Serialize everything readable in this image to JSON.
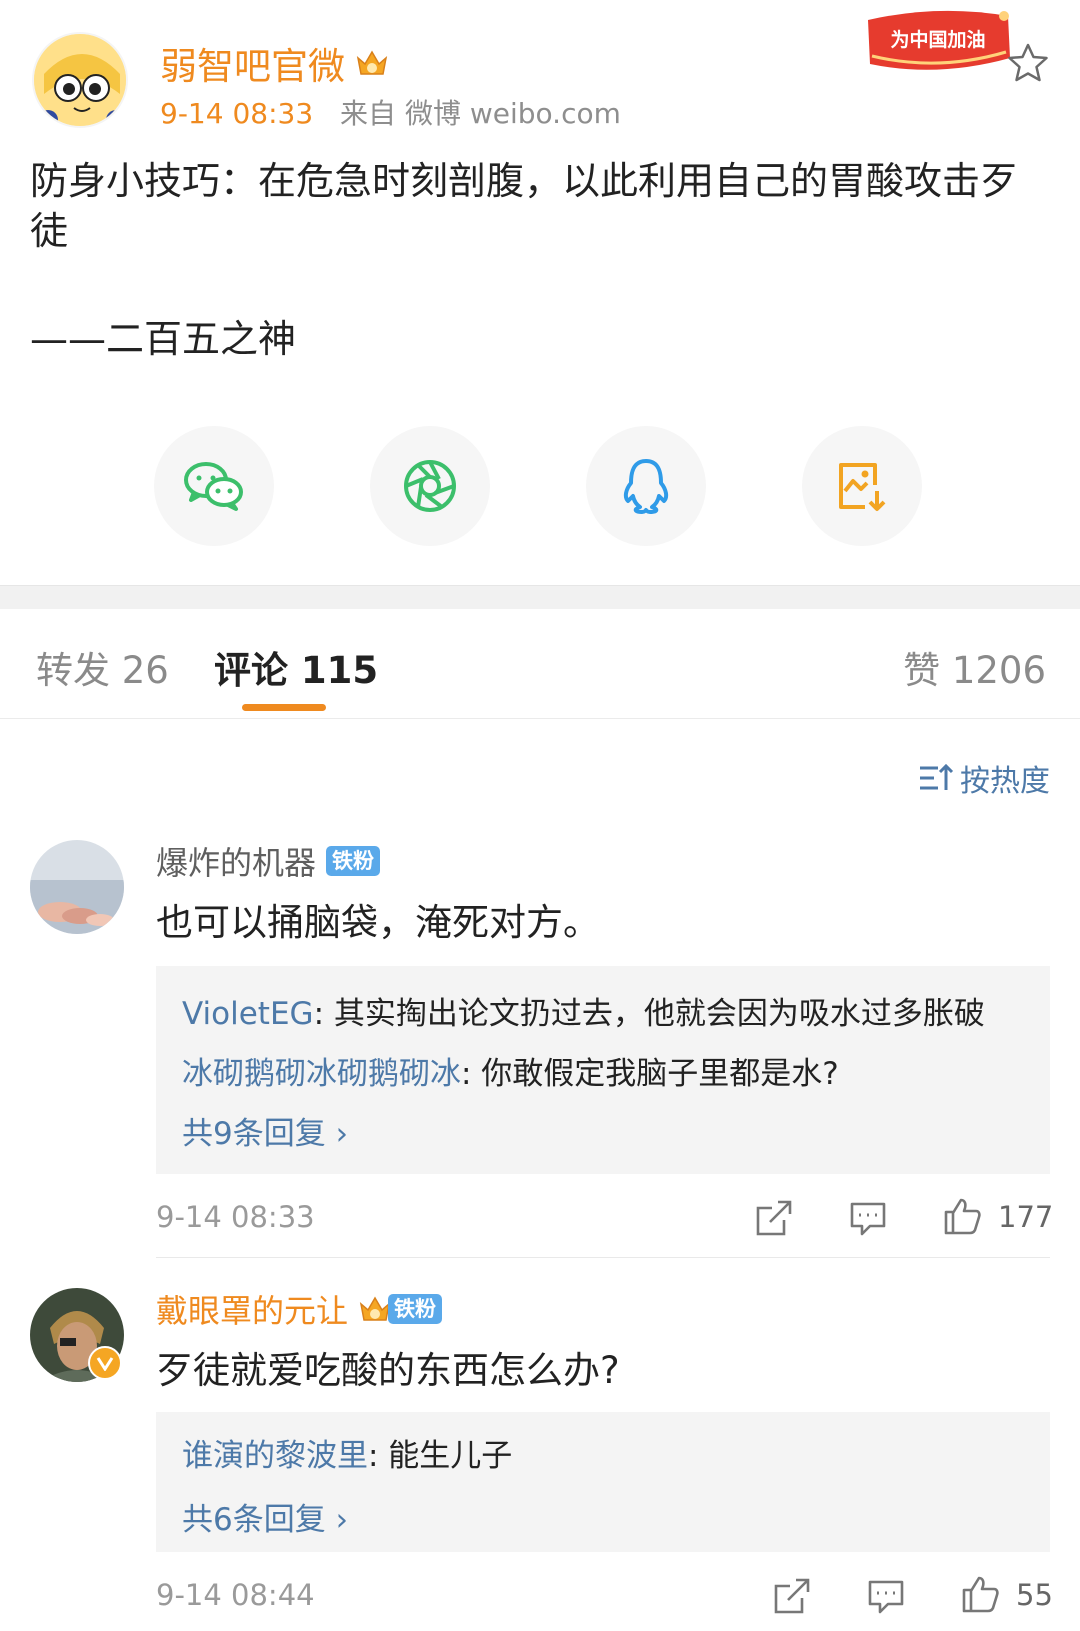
{
  "post": {
    "author": "弱智吧官微",
    "time": "9-14 08:33",
    "source": "来自 微博 weibo.com",
    "campaign_badge": "为中国加油",
    "text": "防身小技巧：在危急时刻剖腹，以此利用自己的胃酸攻击歹徒",
    "signature": "——二百五之神"
  },
  "share": [
    {
      "icon": "wechat-icon",
      "color": "#3cbf6b"
    },
    {
      "icon": "moments-icon",
      "color": "#3cbf6b"
    },
    {
      "icon": "qq-icon",
      "color": "#2f9be8"
    },
    {
      "icon": "save-image-icon",
      "color": "#f2a422"
    }
  ],
  "tabs": {
    "repost": "转发 26",
    "comments": "评论 115",
    "likes": "赞 1206"
  },
  "sort_label": "按热度",
  "comments": [
    {
      "name": "爆炸的机器",
      "badge": "铁粉",
      "text": "也可以捅脑袋，淹死对方。",
      "replies": [
        {
          "name": "VioletEG",
          "text": ": 其实掏出论文扔过去，他就会因为吸水过多胀破"
        },
        {
          "name": "冰砌鹅砌冰砌鹅砌冰",
          "text": ": 你敢假定我脑子里都是水?"
        }
      ],
      "more": "共9条回复 ›",
      "time": "9-14 08:33",
      "likes": "177"
    },
    {
      "name": "戴眼罩的元让",
      "badge": "铁粉",
      "text": "歹徒就爱吃酸的东西怎么办?",
      "replies": [
        {
          "name": "谁演的黎波里",
          "text": ": 能生儿子"
        }
      ],
      "more": "共6条回复 ›",
      "time": "9-14 08:44",
      "likes": "55"
    }
  ]
}
